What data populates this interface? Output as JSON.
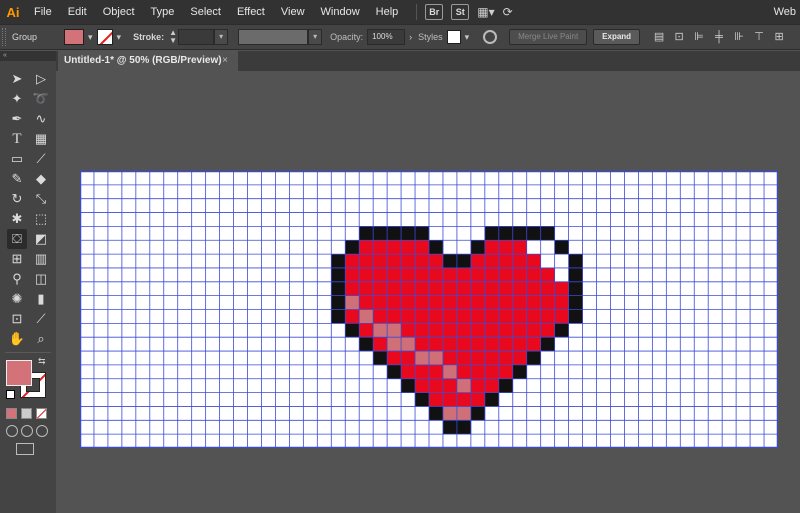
{
  "app": {
    "logo": "Ai"
  },
  "menu": [
    "File",
    "Edit",
    "Object",
    "Type",
    "Select",
    "Effect",
    "View",
    "Window",
    "Help"
  ],
  "ext": {
    "bridge": "Br",
    "stock": "St"
  },
  "workspace": "Web",
  "control": {
    "selection": "Group",
    "stroke_label": "Stroke:",
    "opacity_label": "Opacity:",
    "opacity_value": "100%",
    "styles_label": "Styles",
    "merge_label": "Merge Live Paint",
    "expand_label": "Expand"
  },
  "colors": {
    "fill": "#d4727a",
    "stroke_none": "#e31b1b",
    "heart": "#e8091e",
    "highlight": "#ffffff",
    "shade": "#cf6f78",
    "outline": "#111111",
    "grid": "#3b4ad6"
  },
  "document": {
    "tab": "Untitled-1* @ 50% (RGB/Preview)",
    "close": "×"
  },
  "tools": [
    [
      "selection-tool",
      "direct-selection-tool"
    ],
    [
      "magic-wand-tool",
      "lasso-tool"
    ],
    [
      "pen-tool",
      "curvature-tool"
    ],
    [
      "type-tool",
      "grid-tool"
    ],
    [
      "rectangle-tool",
      "paintbrush-tool"
    ],
    [
      "pencil-tool",
      "eraser-tool"
    ],
    [
      "rotate-tool",
      "scale-tool"
    ],
    [
      "puppet-warp-tool",
      "free-transform-tool"
    ],
    [
      "live-paint-bucket-tool",
      "perspective-grid-tool"
    ],
    [
      "mesh-tool",
      "gradient-tool"
    ],
    [
      "eyedropper-tool",
      "blend-tool"
    ],
    [
      "symbol-sprayer-tool",
      "column-graph-tool"
    ],
    [
      "artboard-tool",
      "slice-tool"
    ],
    [
      "hand-tool",
      "zoom-tool"
    ]
  ]
}
